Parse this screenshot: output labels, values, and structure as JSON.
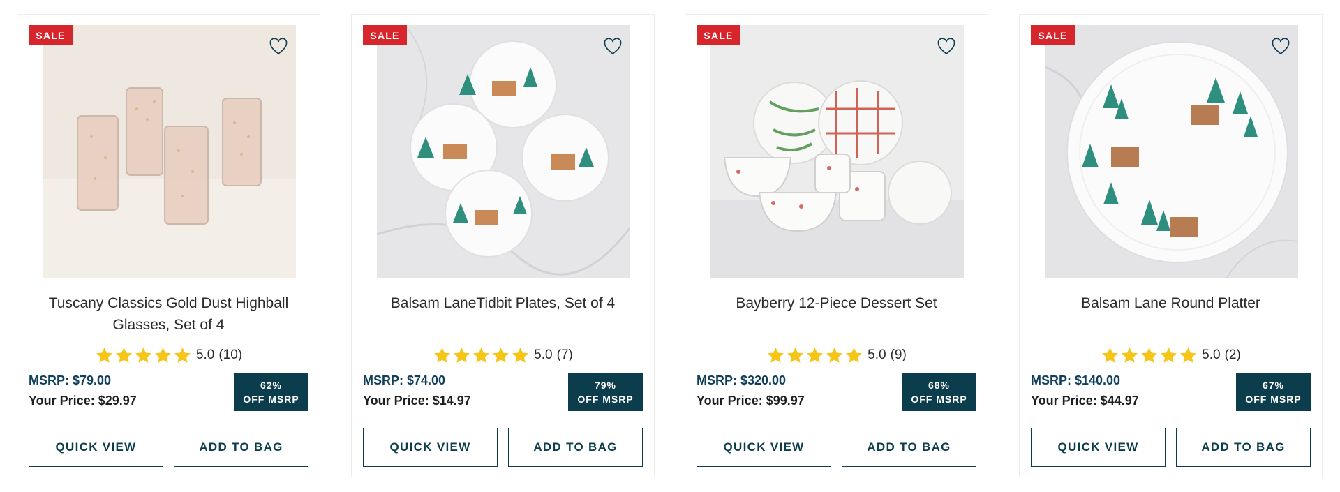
{
  "colors": {
    "sale_red": "#d7262b",
    "brand_teal": "#0c3d4c",
    "star_yellow": "#f5c518",
    "msrp_blue": "#123f5a"
  },
  "products": [
    {
      "badge": "SALE",
      "wishlist_icon": "heart-outline-icon",
      "image_subject": "gold-dust-highball-glasses",
      "name": "Tuscany Classics Gold Dust Highball Glasses, Set of 4",
      "rating_value": 5.0,
      "rating_text": "5.0",
      "review_count": "(10)",
      "msrp": "MSRP: $79.00",
      "your_price": "Your Price: $29.97",
      "discount_pct": "62%",
      "discount_label": "OFF MSRP",
      "quick_view": "QUICK VIEW",
      "add_to_bag": "ADD TO BAG"
    },
    {
      "badge": "SALE",
      "wishlist_icon": "heart-outline-icon",
      "image_subject": "balsam-lane-tidbit-plates",
      "name": "Balsam LaneTidbit Plates, Set of 4",
      "rating_value": 5.0,
      "rating_text": "5.0",
      "review_count": "(7)",
      "msrp": "MSRP: $74.00",
      "your_price": "Your Price: $14.97",
      "discount_pct": "79%",
      "discount_label": "OFF MSRP",
      "quick_view": "QUICK VIEW",
      "add_to_bag": "ADD TO BAG"
    },
    {
      "badge": "SALE",
      "wishlist_icon": "heart-outline-icon",
      "image_subject": "bayberry-dessert-set",
      "name": "Bayberry 12-Piece Dessert Set",
      "rating_value": 5.0,
      "rating_text": "5.0",
      "review_count": "(9)",
      "msrp": "MSRP: $320.00",
      "your_price": "Your Price: $99.97",
      "discount_pct": "68%",
      "discount_label": "OFF MSRP",
      "quick_view": "QUICK VIEW",
      "add_to_bag": "ADD TO BAG"
    },
    {
      "badge": "SALE",
      "wishlist_icon": "heart-outline-icon",
      "image_subject": "balsam-lane-round-platter",
      "name": "Balsam Lane Round Platter",
      "rating_value": 5.0,
      "rating_text": "5.0",
      "review_count": "(2)",
      "msrp": "MSRP: $140.00",
      "your_price": "Your Price: $44.97",
      "discount_pct": "67%",
      "discount_label": "OFF MSRP",
      "quick_view": "QUICK VIEW",
      "add_to_bag": "ADD TO BAG"
    }
  ]
}
